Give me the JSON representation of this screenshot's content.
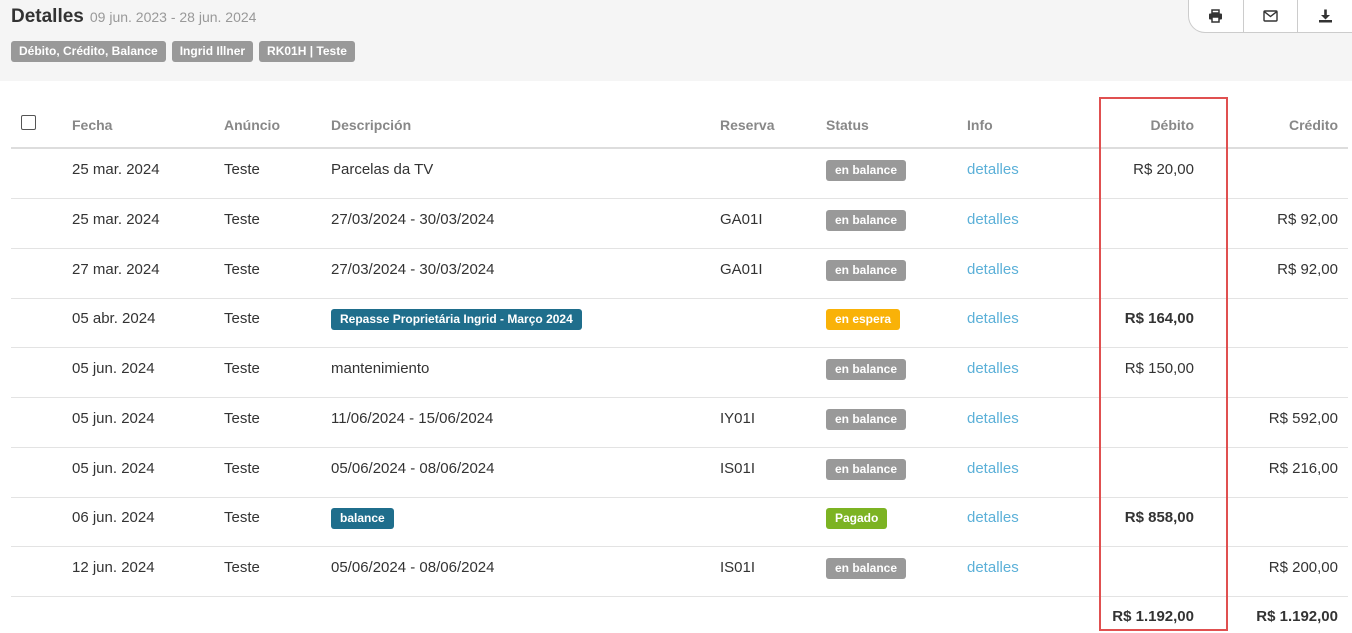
{
  "header": {
    "title": "Detalles",
    "date_range": "09 jun. 2023 - 28 jun. 2024",
    "tags": [
      "Débito, Crédito, Balance",
      "Ingrid Illner",
      "RK01H | Teste"
    ],
    "tools": [
      {
        "icon": "print-icon"
      },
      {
        "icon": "envelope-icon"
      },
      {
        "icon": "download-icon"
      }
    ]
  },
  "colors": {
    "gray_label": "#999999",
    "blue_label": "#1f6e8c",
    "orange_label": "#f9b208",
    "green_label": "#7cb323",
    "link": "#5bb0d8",
    "highlight": "#e05050"
  },
  "table": {
    "columns": {
      "fecha": "Fecha",
      "anuncio": "Anúncio",
      "descripcion": "Descripción",
      "reserva": "Reserva",
      "status": "Status",
      "info": "Info",
      "debito": "Débito",
      "credito": "Crédito"
    },
    "rows": [
      {
        "fecha": "25 mar. 2024",
        "anuncio": "Teste",
        "descripcion": "Parcelas da TV",
        "desc_badge": "",
        "reserva": "",
        "status": "en balance",
        "status_color": "gray",
        "info": "detalles",
        "debito": "R$ 20,00",
        "debito_bold": false,
        "credito": ""
      },
      {
        "fecha": "25 mar. 2024",
        "anuncio": "Teste",
        "descripcion": "27/03/2024 - 30/03/2024",
        "desc_badge": "",
        "reserva": "GA01I",
        "status": "en balance",
        "status_color": "gray",
        "info": "detalles",
        "debito": "",
        "debito_bold": false,
        "credito": "R$ 92,00"
      },
      {
        "fecha": "27 mar. 2024",
        "anuncio": "Teste",
        "descripcion": "27/03/2024 - 30/03/2024",
        "desc_badge": "",
        "reserva": "GA01I",
        "status": "en balance",
        "status_color": "gray",
        "info": "detalles",
        "debito": "",
        "debito_bold": false,
        "credito": "R$ 92,00"
      },
      {
        "fecha": "05 abr. 2024",
        "anuncio": "Teste",
        "descripcion": "",
        "desc_badge": "Repasse Proprietária Ingrid - Março 2024",
        "reserva": "",
        "status": "en espera",
        "status_color": "orange",
        "info": "detalles",
        "debito": "R$ 164,00",
        "debito_bold": true,
        "credito": ""
      },
      {
        "fecha": "05 jun. 2024",
        "anuncio": "Teste",
        "descripcion": "mantenimiento",
        "desc_badge": "",
        "reserva": "",
        "status": "en balance",
        "status_color": "gray",
        "info": "detalles",
        "debito": "R$ 150,00",
        "debito_bold": false,
        "credito": ""
      },
      {
        "fecha": "05 jun. 2024",
        "anuncio": "Teste",
        "descripcion": "11/06/2024 - 15/06/2024",
        "desc_badge": "",
        "reserva": "IY01I",
        "status": "en balance",
        "status_color": "gray",
        "info": "detalles",
        "debito": "",
        "debito_bold": false,
        "credito": "R$ 592,00"
      },
      {
        "fecha": "05 jun. 2024",
        "anuncio": "Teste",
        "descripcion": "05/06/2024 - 08/06/2024",
        "desc_badge": "",
        "reserva": "IS01I",
        "status": "en balance",
        "status_color": "gray",
        "info": "detalles",
        "debito": "",
        "debito_bold": false,
        "credito": "R$ 216,00"
      },
      {
        "fecha": "06 jun. 2024",
        "anuncio": "Teste",
        "descripcion": "",
        "desc_badge": "balance",
        "reserva": "",
        "status": "Pagado",
        "status_color": "green",
        "info": "detalles",
        "debito": "R$ 858,00",
        "debito_bold": true,
        "credito": ""
      },
      {
        "fecha": "12 jun. 2024",
        "anuncio": "Teste",
        "descripcion": "05/06/2024 - 08/06/2024",
        "desc_badge": "",
        "reserva": "IS01I",
        "status": "en balance",
        "status_color": "gray",
        "info": "detalles",
        "debito": "",
        "debito_bold": false,
        "credito": "R$ 200,00"
      }
    ],
    "totals": {
      "debito": "R$ 1.192,00",
      "credito": "R$ 1.192,00"
    }
  }
}
